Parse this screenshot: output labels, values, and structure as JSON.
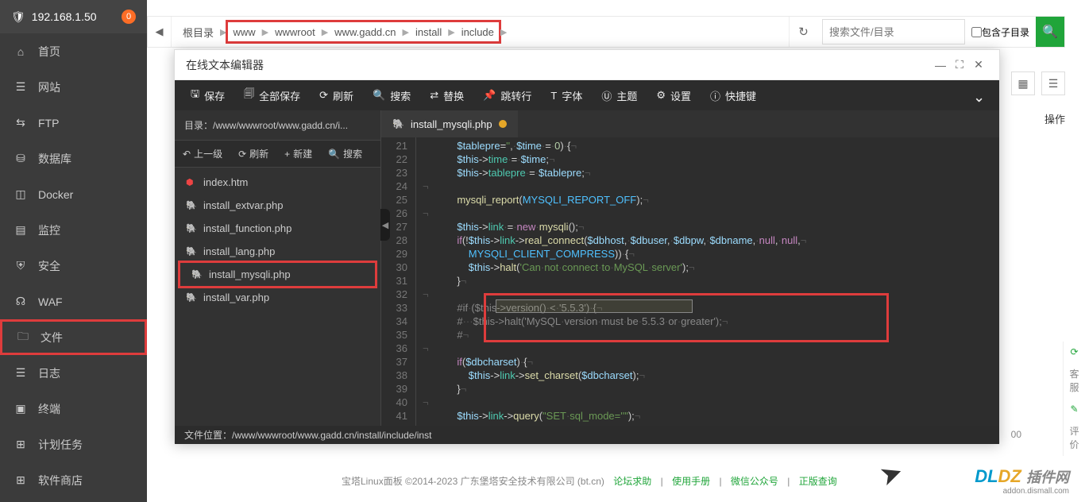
{
  "sidebar": {
    "ip": "192.168.1.50",
    "badge": "0",
    "items": [
      {
        "icon": "⌂",
        "label": "首页"
      },
      {
        "icon": "☰",
        "label": "网站"
      },
      {
        "icon": "⇆",
        "label": "FTP"
      },
      {
        "icon": "⛁",
        "label": "数据库"
      },
      {
        "icon": "◫",
        "label": "Docker"
      },
      {
        "icon": "▤",
        "label": "监控"
      },
      {
        "icon": "⛨",
        "label": "安全"
      },
      {
        "icon": "☊",
        "label": "WAF"
      },
      {
        "icon": "🗀",
        "label": "文件",
        "highlighted": true
      },
      {
        "icon": "☰",
        "label": "日志"
      },
      {
        "icon": "▣",
        "label": "终端"
      },
      {
        "icon": "⊞",
        "label": "计划任务"
      },
      {
        "icon": "⊞",
        "label": "软件商店"
      }
    ]
  },
  "breadcrumb": {
    "root": "根目录",
    "parts": [
      "www",
      "wwwroot",
      "www.gadd.cn",
      "install",
      "include"
    ]
  },
  "search": {
    "placeholder": "搜索文件/目录",
    "sub_label": "包含子目录"
  },
  "op_header": "操作",
  "page_count": "00",
  "modal": {
    "title": "在线文本编辑器",
    "toolbar": [
      {
        "icon": "🖫",
        "label": "保存"
      },
      {
        "icon": "🗐",
        "label": "全部保存"
      },
      {
        "icon": "⟳",
        "label": "刷新"
      },
      {
        "icon": "🔍",
        "label": "搜索"
      },
      {
        "icon": "⇄",
        "label": "替换"
      },
      {
        "icon": "📌",
        "label": "跳转行"
      },
      {
        "icon": "T",
        "label": "字体"
      },
      {
        "icon": "Ⓤ",
        "label": "主题"
      },
      {
        "icon": "⚙",
        "label": "设置"
      },
      {
        "icon": "ⓘ",
        "label": "快捷键"
      }
    ],
    "path_label": "目录：/www/wwwroot/www.gadd.cn/i...",
    "file_tools": [
      {
        "icon": "↶",
        "label": "上一级"
      },
      {
        "icon": "⟳",
        "label": "刷新"
      },
      {
        "icon": "+",
        "label": "新建"
      },
      {
        "icon": "🔍",
        "label": "搜索"
      }
    ],
    "files": [
      {
        "type": "html",
        "name": "index.htm"
      },
      {
        "type": "php",
        "name": "install_extvar.php"
      },
      {
        "type": "php",
        "name": "install_function.php"
      },
      {
        "type": "php",
        "name": "install_lang.php"
      },
      {
        "type": "php",
        "name": "install_mysqli.php",
        "highlighted": true
      },
      {
        "type": "php",
        "name": "install_var.php"
      }
    ],
    "active_tab": "install_mysqli.php",
    "line_start": 21,
    "line_end": 41,
    "footer": "文件位置：/www/wwwroot/www.gadd.cn/install/include/inst"
  },
  "page_footer": {
    "text": "宝塔Linux面板 ©2014-2023 广东堡塔安全技术有限公司 (bt.cn)",
    "links": [
      "论坛求助",
      "使用手册",
      "微信公众号",
      "正版查询"
    ]
  },
  "side_widgets": [
    "⟳",
    "客服",
    "✎",
    "评价"
  ],
  "watermark": {
    "t1": "DL",
    "t2": "DZ",
    "t3": "插件网",
    "sub": "addon.dismall.com"
  }
}
